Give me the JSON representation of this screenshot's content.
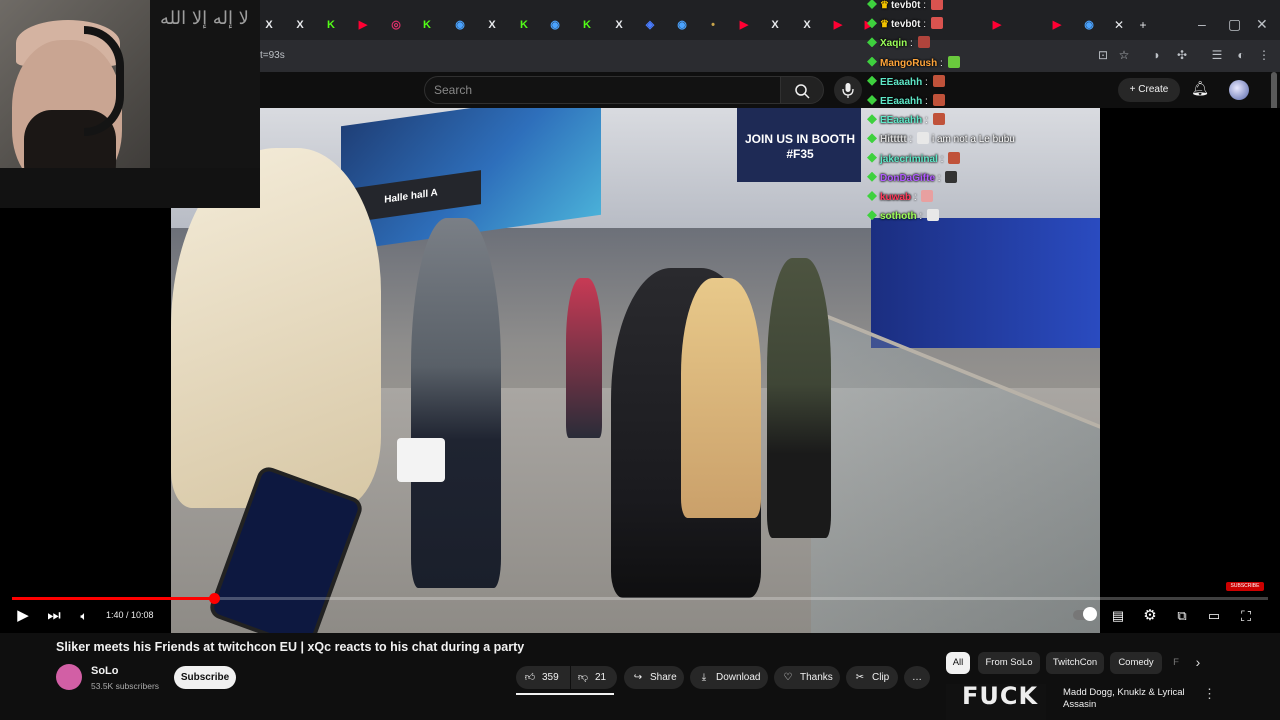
{
  "browser": {
    "url_fragment": "t=93s",
    "tab_icons": [
      {
        "glyph": "X",
        "color": "#e8eaed"
      },
      {
        "glyph": "X",
        "color": "#e8eaed"
      },
      {
        "glyph": "K",
        "color": "#53fc18"
      },
      {
        "glyph": "▶",
        "color": "#ff0033"
      },
      {
        "glyph": "◎",
        "color": "#e1306c"
      },
      {
        "glyph": "K",
        "color": "#53fc18"
      },
      {
        "glyph": "◉",
        "color": "#4aa3ff"
      },
      {
        "glyph": "X",
        "color": "#e8eaed"
      },
      {
        "glyph": "K",
        "color": "#53fc18"
      },
      {
        "glyph": "◉",
        "color": "#4aa3ff"
      },
      {
        "glyph": "K",
        "color": "#53fc18"
      },
      {
        "glyph": "X",
        "color": "#e8eaed"
      },
      {
        "glyph": "◈",
        "color": "#4a7dff"
      },
      {
        "glyph": "◉",
        "color": "#4aa3ff"
      },
      {
        "glyph": "•",
        "color": "#c8a44a"
      },
      {
        "glyph": "▶",
        "color": "#ff0033"
      },
      {
        "glyph": "X",
        "color": "#e8eaed"
      },
      {
        "glyph": "X",
        "color": "#e8eaed"
      },
      {
        "glyph": "▶",
        "color": "#ff0033"
      },
      {
        "glyph": "▶",
        "color": "#ff0033"
      },
      {
        "glyph": "▶",
        "color": "#ff0033"
      },
      {
        "glyph": "▶",
        "color": "#ff0033"
      },
      {
        "glyph": "◉",
        "color": "#4aa3ff"
      }
    ]
  },
  "youtube": {
    "search_placeholder": "Search",
    "create_label": "Create",
    "player": {
      "time_text": "1:40 / 10:08",
      "progress_fraction": 0.161,
      "watermark": "SUBSCRIBE"
    },
    "video_overlay_text": {
      "booth": "JOIN US IN BOOTH #F35",
      "hall_sign": "Halle hall A"
    },
    "video_title": "Sliker meets his Friends at twitchcon EU | xQc reacts to his chat during a party",
    "channel": {
      "name": "SoLo",
      "subscribers": "53.5K subscribers",
      "subscribe_label": "Subscribe"
    },
    "actions": {
      "likes": "359",
      "dislikes": "21",
      "share": "Share",
      "download": "Download",
      "thanks": "Thanks",
      "clip": "Clip",
      "more": "…"
    },
    "chips": [
      "All",
      "From SoLo",
      "TwitchCon",
      "Comedy",
      "F"
    ],
    "recommendation": {
      "thumb_text": "FUCK",
      "title": "Madd Dogg, Knuklz & Lyrical Assasin"
    }
  },
  "chat": [
    {
      "user": "tevb0t",
      "color": "#f1f1f1",
      "crown": true,
      "msg": "",
      "emote_color": "#d9534f"
    },
    {
      "user": "tevb0t",
      "color": "#f1f1f1",
      "crown": true,
      "msg": "",
      "emote_color": "#d9534f"
    },
    {
      "user": "Xaqin",
      "color": "#9cff5a",
      "crown": false,
      "msg": "",
      "emote_color": "#b0443c"
    },
    {
      "user": "MangoRush",
      "color": "#ffa53b",
      "crown": false,
      "msg": "",
      "emote_color": "#6ac93d"
    },
    {
      "user": "EEaaahh",
      "color": "#5fe8c8",
      "crown": false,
      "msg": "",
      "emote_color": "#c0523a"
    },
    {
      "user": "EEaaahh",
      "color": "#5fe8c8",
      "crown": false,
      "msg": "",
      "emote_color": "#c0523a"
    },
    {
      "user": "EEaaahh",
      "color": "#5fe8c8",
      "crown": false,
      "msg": "",
      "emote_color": "#c0523a"
    },
    {
      "user": "Hittttt",
      "color": "#dcdcdc",
      "crown": false,
      "msg": "i am not a Le bubu",
      "emote_color": "#e8e8e8"
    },
    {
      "user": "jakecriminal",
      "color": "#5fe8c8",
      "crown": false,
      "msg": "",
      "emote_color": "#c0523a"
    },
    {
      "user": "DonDaGifte",
      "color": "#b15aff",
      "crown": false,
      "msg": "",
      "emote_color": "#333"
    },
    {
      "user": "kuwab",
      "color": "#ff3b5c",
      "crown": false,
      "msg": "",
      "emote_color": "#e8a0a0"
    },
    {
      "user": "sothoth",
      "color": "#9cff5a",
      "crown": false,
      "msg": "",
      "emote_color": "#e8e8e8"
    }
  ],
  "webcam": {
    "flag_text": "لا إله إلا الله"
  }
}
